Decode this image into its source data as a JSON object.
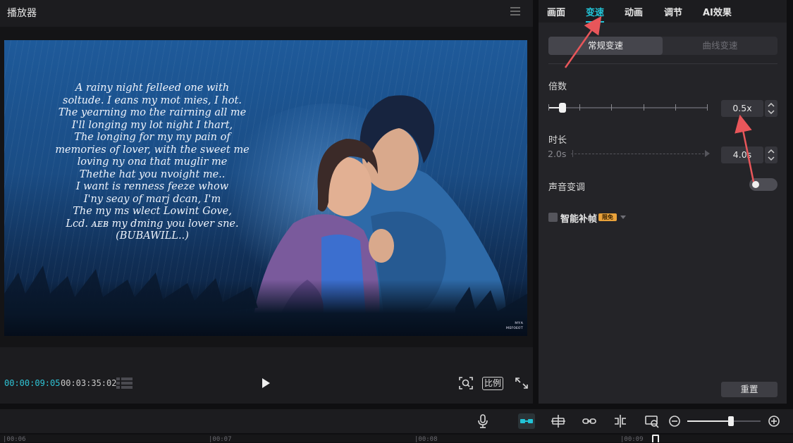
{
  "player": {
    "title": "播放器",
    "time_current": "00:00:09:05",
    "time_total": "00:03:35:02",
    "ratio_label": "比例"
  },
  "preview": {
    "poem_lines": [
      "A rainy night felleed one with",
      "soltude. I eans my mot mies, I hot.",
      "The yearning mo the rairning all me",
      "I'll longing my lot night I thart,",
      "The longing for my my pain of",
      "memories of lover, with the sweet me",
      "loving ny ona that muglir me",
      "Thethe hat you nvoight me..",
      "I want is renness feeze whow",
      "I'ny seay of marj dcan, I'm",
      "The my ms wlect Lowint Gove,",
      "Lcd. ᴀᴇʙ my dming you lover sne.",
      "(BUBAWILL..)"
    ],
    "watermark_lines": [
      "ᴍʏᴀ",
      "ᴍᴇꜰᴏᴇᴏᴛ"
    ]
  },
  "inspector": {
    "tabs": [
      {
        "label": "画面",
        "active": false
      },
      {
        "label": "变速",
        "active": true
      },
      {
        "label": "动画",
        "active": false
      },
      {
        "label": "调节",
        "active": false
      },
      {
        "label": "AI效果",
        "active": false
      }
    ],
    "speed_modes": {
      "normal": "常规变速",
      "curve": "曲线变速"
    },
    "multiplier_label": "倍数",
    "multiplier_value": "0.5x",
    "multiplier_fraction": 0.09,
    "duration_label": "时长",
    "duration_start": "2.0s",
    "duration_value": "4.0s",
    "pitch_label": "声音变调",
    "pitch_enabled": false,
    "smart_frame_label": "智能补帧",
    "smart_frame_badge": "限免",
    "smart_frame_checked": false,
    "reset_label": "重置"
  },
  "timeline": {
    "ruler_labels": [
      "|00:06",
      "|00:07",
      "|00:08",
      "|00:09"
    ],
    "zoom_fraction": 0.6
  },
  "colors": {
    "accent": "#22c4d7",
    "annotation": "#e8565a",
    "badge": "#e9a23b"
  }
}
